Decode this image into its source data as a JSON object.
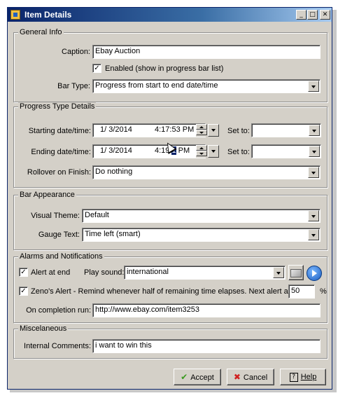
{
  "window": {
    "title": "Item Details",
    "minimize": "_",
    "maximize": "□",
    "close": "✕"
  },
  "general": {
    "legend": "General Info",
    "caption_label": "Caption:",
    "caption_value": "Ebay Auction",
    "enabled_label": "Enabled (show in progress bar list)",
    "enabled_checked": "✓",
    "bartype_label": "Bar Type:",
    "bartype_value": "Progress from start to end date/time"
  },
  "progress": {
    "legend": "Progress Type Details",
    "start_label": "Starting date/time:",
    "start_date": "1/  3/2014",
    "start_time": "4:17:53 PM",
    "start_setto": "Set to:",
    "end_label": "Ending date/time:",
    "end_date": "1/  3/2014",
    "end_time_a": "4:19:",
    "end_time_sel": "1",
    "end_time_b": " PM",
    "end_setto": "Set to:",
    "rollover_label": "Rollover on Finish:",
    "rollover_value": "Do nothing"
  },
  "appearance": {
    "legend": "Bar Appearance",
    "theme_label": "Visual Theme:",
    "theme_value": "Default",
    "gauge_label": "Gauge Text:",
    "gauge_value": "Time left (smart)"
  },
  "alarms": {
    "legend": "Alarms and Notifications",
    "alert_end_label": "Alert at end",
    "alert_end_checked": "✓",
    "play_label": "Play sound:",
    "sound_value": "international",
    "zeno_checked": "✓",
    "zeno_label": "Zeno's Alert - Remind whenever half of remaining time elapses.  Next alert at:",
    "zeno_value": "50",
    "zeno_unit": "%",
    "completion_label": "On completion run:",
    "completion_value": "http://www.ebay.com/item3253"
  },
  "misc": {
    "legend": "Miscelaneous",
    "comments_label": "Internal Comments:",
    "comments_value": "i want to win this"
  },
  "buttons": {
    "accept": "Accept",
    "cancel": "Cancel",
    "help": "Help"
  },
  "icons": {
    "accept": "checkmark-icon",
    "cancel": "x-icon",
    "help": "help-icon",
    "sound_browse": "folder-icon",
    "play": "play-icon"
  },
  "colors": {
    "title_start": "#0a246a",
    "title_end": "#a6caf0",
    "face": "#d4d0c8",
    "selection": "#0a246a"
  }
}
